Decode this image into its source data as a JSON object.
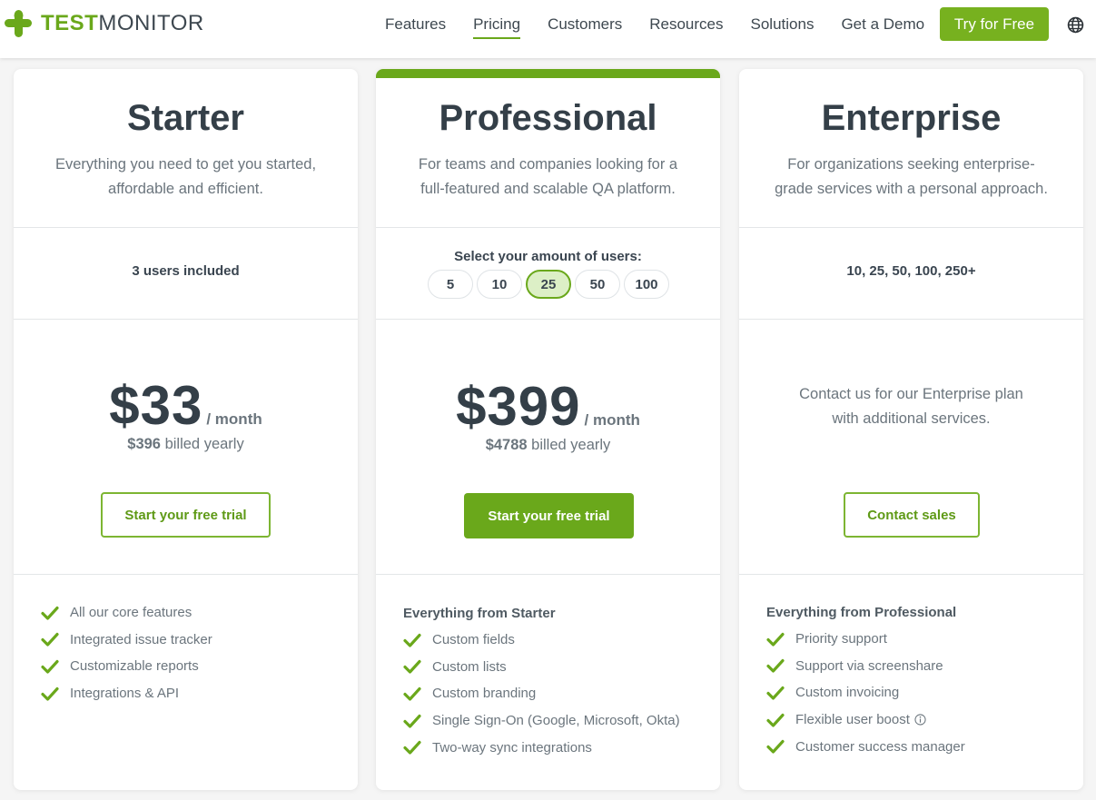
{
  "header": {
    "logo": {
      "text_bold": "TEST",
      "text_regular": "MONITOR",
      "icon": "plus-cross-logo-icon",
      "brand_color": "#6aa81b"
    },
    "nav": [
      {
        "label": "Features",
        "active": false
      },
      {
        "label": "Pricing",
        "active": true
      },
      {
        "label": "Customers",
        "active": false
      },
      {
        "label": "Resources",
        "active": false
      },
      {
        "label": "Solutions",
        "active": false
      }
    ],
    "demo_label": "Get a Demo",
    "try_label": "Try for Free",
    "language_icon": "globe-icon"
  },
  "plans": {
    "starter": {
      "title": "Starter",
      "desc_line1": "Everything you need to get you started,",
      "desc_line2": "affordable and efficient.",
      "users": "3 users included",
      "price": "$33",
      "per": "/ month",
      "billed_amount": "$396",
      "billed_text": " billed yearly",
      "cta": "Start your free trial",
      "features": [
        "All our core features",
        "Integrated issue tracker",
        "Customizable reports",
        "Integrations & API"
      ]
    },
    "professional": {
      "title": "Professional",
      "desc_line1": "For teams and companies looking for a",
      "desc_line2": "full-featured and scalable QA platform.",
      "users_label": "Select your amount of users:",
      "user_options": [
        "5",
        "10",
        "25",
        "50",
        "100"
      ],
      "selected_users": "25",
      "price": "$399",
      "per": "/ month",
      "billed_amount": "$4788",
      "billed_text": " billed yearly",
      "cta": "Start your free trial",
      "features_heading": "Everything from Starter",
      "features": [
        "Custom fields",
        "Custom lists",
        "Custom branding",
        "Single Sign-On (Google, Microsoft, Okta)",
        "Two-way sync integrations"
      ]
    },
    "enterprise": {
      "title": "Enterprise",
      "desc_line1": "For organizations seeking enterprise-",
      "desc_line2": "grade services with a personal approach.",
      "users": "10, 25, 50, 100, 250+",
      "contact_line1": "Contact us for our Enterprise plan",
      "contact_line2": "with additional services.",
      "cta": "Contact sales",
      "features_heading": "Everything from Professional",
      "features": [
        "Priority support",
        "Support via screenshare",
        "Custom invoicing",
        "Flexible user boost",
        "Customer success manager"
      ]
    }
  },
  "colors": {
    "accent": "#6aa81b",
    "text_dark": "#343f48",
    "text_muted": "#6b757d"
  }
}
